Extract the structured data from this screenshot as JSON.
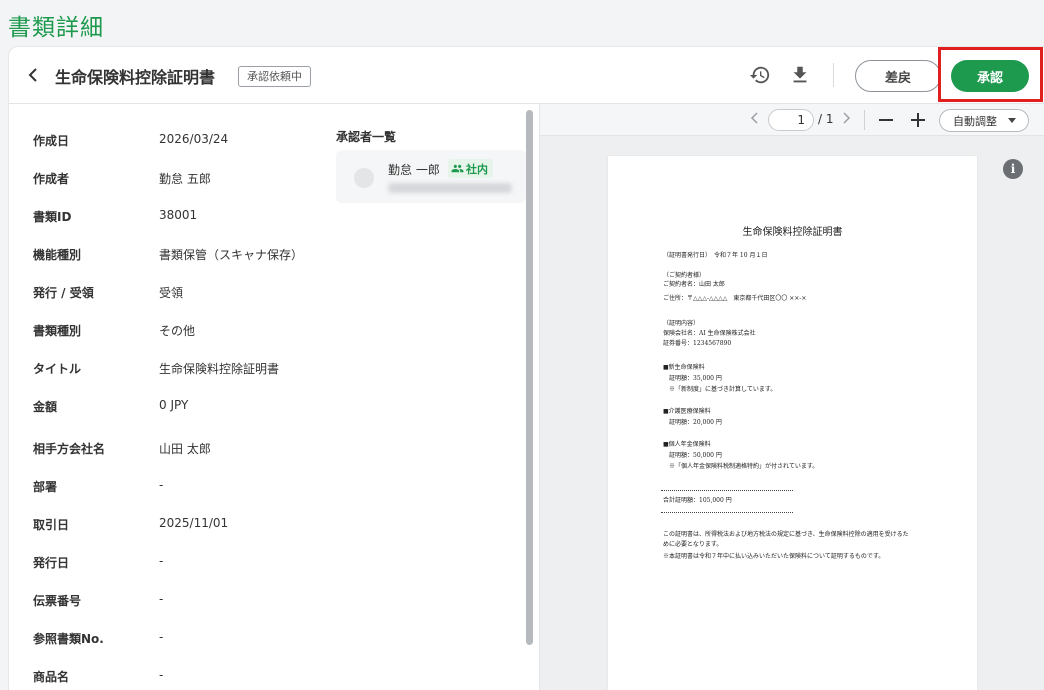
{
  "page": {
    "title": "書類詳細"
  },
  "header": {
    "document_title": "生命保険料控除証明書",
    "status": "承認依頼中",
    "reject_label": "差戻",
    "approve_label": "承認"
  },
  "info": [
    {
      "label": "作成日",
      "value": "2026/03/24"
    },
    {
      "label": "作成者",
      "value": "勤怠 五郎"
    },
    {
      "label": "書類ID",
      "value": "38001"
    },
    {
      "label": "機能種別",
      "value": "書類保管（スキャナ保存）"
    },
    {
      "label": "発行 / 受領",
      "value": "受領"
    },
    {
      "label": "書類種別",
      "value": "その他"
    },
    {
      "label": "タイトル",
      "value": "生命保険料控除証明書"
    },
    {
      "label": "金額",
      "value": "0 JPY"
    },
    {
      "label": "相手方会社名",
      "value": "山田 太郎"
    },
    {
      "label": "部署",
      "value": "-"
    },
    {
      "label": "取引日",
      "value": "2025/11/01"
    },
    {
      "label": "発行日",
      "value": "-"
    },
    {
      "label": "伝票番号",
      "value": "-"
    },
    {
      "label": "参照書類No.",
      "value": "-"
    },
    {
      "label": "商品名",
      "value": "-"
    }
  ],
  "approvers": {
    "title": "承認者一覧",
    "items": [
      {
        "name": "勤怠 一郎",
        "badge": "社内"
      }
    ]
  },
  "viewer": {
    "page_current": "1",
    "page_total": "/ 1",
    "zoom": "自動調整"
  },
  "pdf": {
    "title": "生命保険料控除証明書",
    "lines": [
      "（証明書発行日）　令和７年 10 月１日",
      "（ご契約者様）",
      "ご契約者名：山田 太郎",
      "ご住所：〒△△△-△△△△　東京都千代田区〇〇 ××-×",
      "（証明内容）",
      "保険会社名：AI 生命保険株式会社",
      "証券番号：1234567890",
      "■新生命保険料",
      "　証明額：35,000 円",
      "　※「新制度」に基づき計算しています。",
      "■介護医療保険料",
      "　証明額：20,000 円",
      "■個人年金保険料",
      "　証明額：50,000 円",
      "　※「個人年金保険料税制適格特約」が付されています。",
      "合計証明額：105,000 円",
      "この証明書は、所得税法および地方税法の規定に基づき、生命保険料控除の適用を受けるた",
      "めに必要となります。",
      "※本証明書は令和７年中に払い込みいただいた保険料について証明するものです。"
    ]
  }
}
